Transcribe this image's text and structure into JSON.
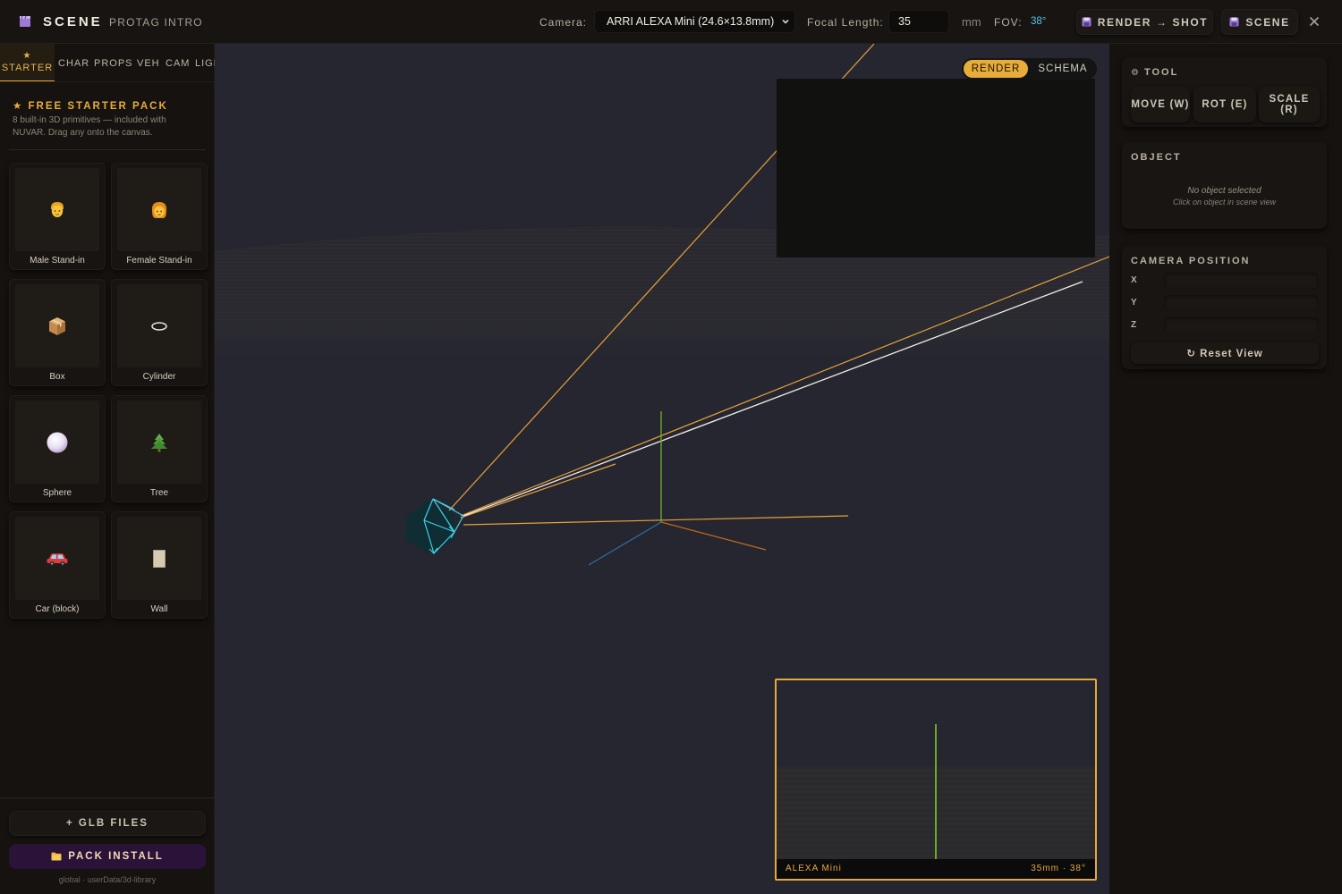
{
  "header": {
    "app_title": "SCENE",
    "scene_name": "PROTAG INTRO",
    "camera_label": "Camera:",
    "camera_value": "ARRI ALEXA Mini (24.6×13.8mm)",
    "focal_label": "Focal Length:",
    "focal_value": "35",
    "focal_unit": "mm",
    "fov_label": "FOV:",
    "fov_value": "38°",
    "render_shot_label": "RENDER → SHOT",
    "scene_button_label": "SCENE",
    "colors": {
      "accent": "#e8ac3a",
      "fov": "#56c8ea",
      "icon": "#9b7bd6"
    }
  },
  "sidebar": {
    "tabs": [
      {
        "label": "STARTER",
        "icon": "star-icon",
        "active": true
      },
      {
        "label": "CHAR"
      },
      {
        "label": "PROPS"
      },
      {
        "label": "VEH"
      },
      {
        "label": "CAM"
      },
      {
        "label": "LIGH"
      }
    ],
    "pack_title": "★ FREE STARTER PACK",
    "pack_description": "8 built-in 3D primitives — included with NUVAR. Drag any onto the canvas.",
    "items": [
      {
        "label": "Male Stand-in",
        "icon": "male-person-icon"
      },
      {
        "label": "Female Stand-in",
        "icon": "female-person-icon"
      },
      {
        "label": "Box",
        "icon": "box-icon"
      },
      {
        "label": "Cylinder",
        "icon": "cylinder-icon"
      },
      {
        "label": "Sphere",
        "icon": "sphere-icon"
      },
      {
        "label": "Tree",
        "icon": "tree-icon"
      },
      {
        "label": "Car (block)",
        "icon": "car-icon"
      },
      {
        "label": "Wall",
        "icon": "wall-icon"
      }
    ],
    "glb_button": "+ GLB FILES",
    "pack_install_button": "PACK INSTALL",
    "library_path": "global · userData/3d-library"
  },
  "viewport": {
    "toggle": {
      "render": "RENDER",
      "schema": "SCHEMA",
      "active": "RENDER"
    },
    "preview": {
      "camera_name": "ALEXA Mini",
      "camera_spec": "35mm · 38°"
    }
  },
  "right_panel": {
    "tool": {
      "title": "TOOL",
      "buttons": [
        "MOVE (W)",
        "ROT (E)",
        "SCALE (R)"
      ]
    },
    "object": {
      "title": "OBJECT",
      "empty_title": "No object selected",
      "empty_hint": "Click on object in scene view"
    },
    "camera_position": {
      "title": "CAMERA POSITION",
      "x_label": "X",
      "y_label": "Y",
      "z_label": "Z",
      "x": "",
      "y": "",
      "z": "",
      "reset_label": "↻ Reset View"
    }
  }
}
